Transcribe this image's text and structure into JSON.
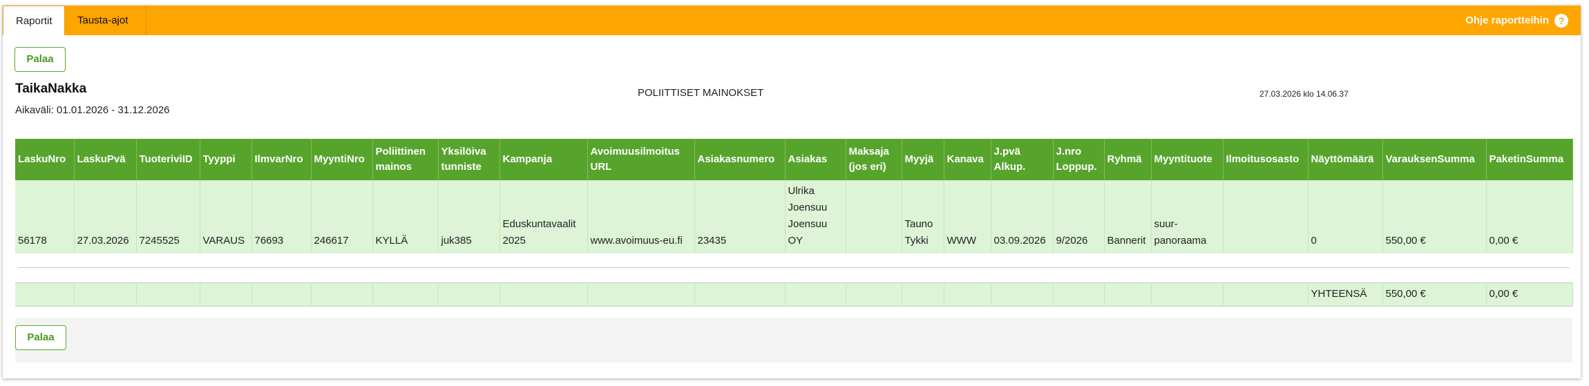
{
  "tabs": [
    {
      "label": "Raportit"
    },
    {
      "label": "Tausta-ajot"
    }
  ],
  "help": {
    "label": "Ohje raportteihin",
    "icon": "?"
  },
  "buttons": {
    "back_label": "Palaa"
  },
  "report": {
    "title": "TaikaNakka",
    "range": "Aikaväli: 01.01.2026 - 31.12.2026",
    "center_title": "POLIITTISET MAINOKSET",
    "generated": "27.03.2026 klo 14.06.37"
  },
  "table": {
    "headers": [
      [
        "LaskuNro"
      ],
      [
        "LaskuPvä"
      ],
      [
        "TuoteriviID"
      ],
      [
        "Tyyppi"
      ],
      [
        "IlmvarNro"
      ],
      [
        "MyyntiNro"
      ],
      [
        "Poliittinen",
        "mainos"
      ],
      [
        "Yksilöiva",
        "tunniste"
      ],
      [
        "Kampanja"
      ],
      [
        "Avoimuusilmoitus",
        "URL"
      ],
      [
        "Asiakasnumero"
      ],
      [
        "Asiakas"
      ],
      [
        "Maksaja",
        "(jos eri)"
      ],
      [
        "Myyjä"
      ],
      [
        "Kanava"
      ],
      [
        "J.pvä",
        "Alkup."
      ],
      [
        "J.nro",
        "Loppup."
      ],
      [
        "Ryhmä"
      ],
      [
        "Myyntituote"
      ],
      [
        "Ilmoitusosasto"
      ],
      [
        "Näyttömäärä"
      ],
      [
        "VarauksenSumma"
      ],
      [
        "PaketinSumma"
      ]
    ],
    "rows": [
      [
        [
          "56178"
        ],
        [
          "27.03.2026"
        ],
        [
          "7245525"
        ],
        [
          "VARAUS"
        ],
        [
          "76693"
        ],
        [
          "246617"
        ],
        [
          "KYLLÄ"
        ],
        [
          "juk385"
        ],
        [
          "Eduskuntavaalit",
          "2025"
        ],
        [
          "www.avoimuus-eu.fi"
        ],
        [
          "23435"
        ],
        [
          "Ulrika",
          "Joensuu",
          "Joensuu",
          "OY"
        ],
        [
          ""
        ],
        [
          "Tauno",
          "Tykki"
        ],
        [
          "WWW"
        ],
        [
          "03.09.2026"
        ],
        [
          "9/2026"
        ],
        [
          "Bannerit"
        ],
        [
          "suur-",
          "panoraama"
        ],
        [
          ""
        ],
        [
          "0"
        ],
        [
          "550,00 €"
        ],
        [
          "0,00 €"
        ]
      ]
    ],
    "totals": {
      "label": "YHTEENSÄ",
      "varaus_sum": "550,00 €",
      "paketti_sum": "0,00 €"
    }
  },
  "colors": {
    "topbar": "#ffa500",
    "header": "#57a42c",
    "row": "#ddf4d6",
    "button_text": "#4a9a22"
  }
}
